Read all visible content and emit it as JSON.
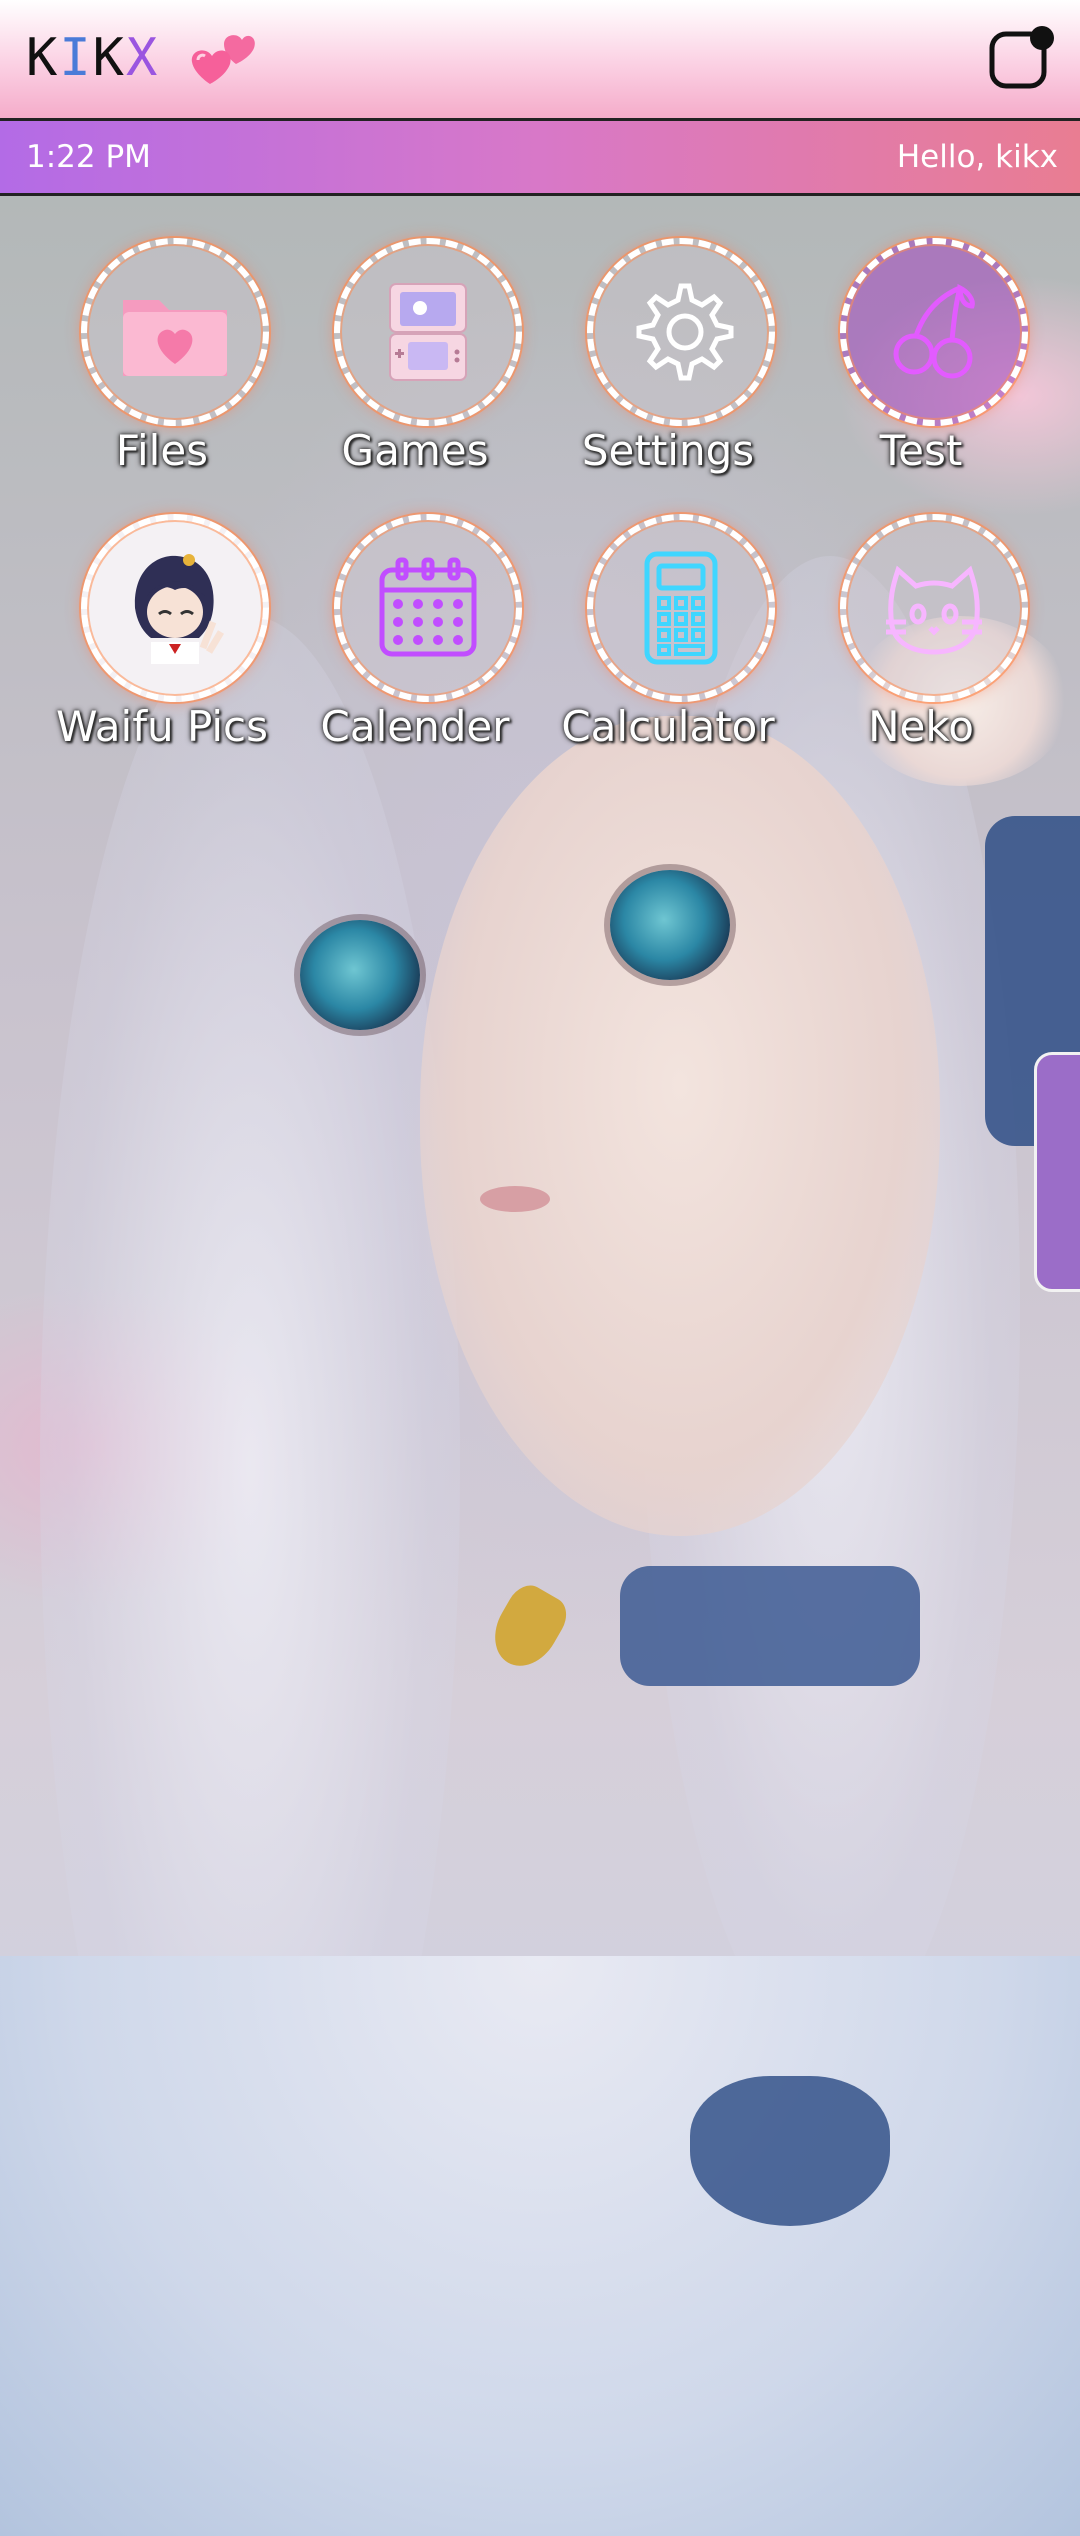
{
  "header": {
    "brand_letters": [
      {
        "char": "K",
        "color": "#111111"
      },
      {
        "char": "I",
        "color": "#4a7bd8"
      },
      {
        "char": "K",
        "color": "#111111"
      },
      {
        "char": "X",
        "color": "#9a55e0"
      }
    ],
    "heart_icon": "two-hearts-icon",
    "corner_icon": "notification-square-icon"
  },
  "status": {
    "time": "1:22 PM",
    "greeting": "Hello, kikx"
  },
  "apps": [
    {
      "label": "Files",
      "icon": "pink-folder-heart-icon"
    },
    {
      "label": "Games",
      "icon": "handheld-console-icon"
    },
    {
      "label": "Settings",
      "icon": "gear-icon"
    },
    {
      "label": "Test",
      "icon": "neon-cherry-icon"
    },
    {
      "label": "Waifu Pics",
      "icon": "anime-girl-avatar-icon"
    },
    {
      "label": "Calender",
      "icon": "neon-calendar-icon"
    },
    {
      "label": "Calculator",
      "icon": "neon-calculator-icon"
    },
    {
      "label": "Neko",
      "icon": "neon-cat-icon"
    }
  ],
  "wallpaper": "anime-girl-wallpaper",
  "colors": {
    "topbar": "#f5acca",
    "statusbar_start": "#b36be6",
    "statusbar_end": "#e97d92",
    "ring_glow": "#ff8c50",
    "side_handle": "#9b6dc8"
  }
}
